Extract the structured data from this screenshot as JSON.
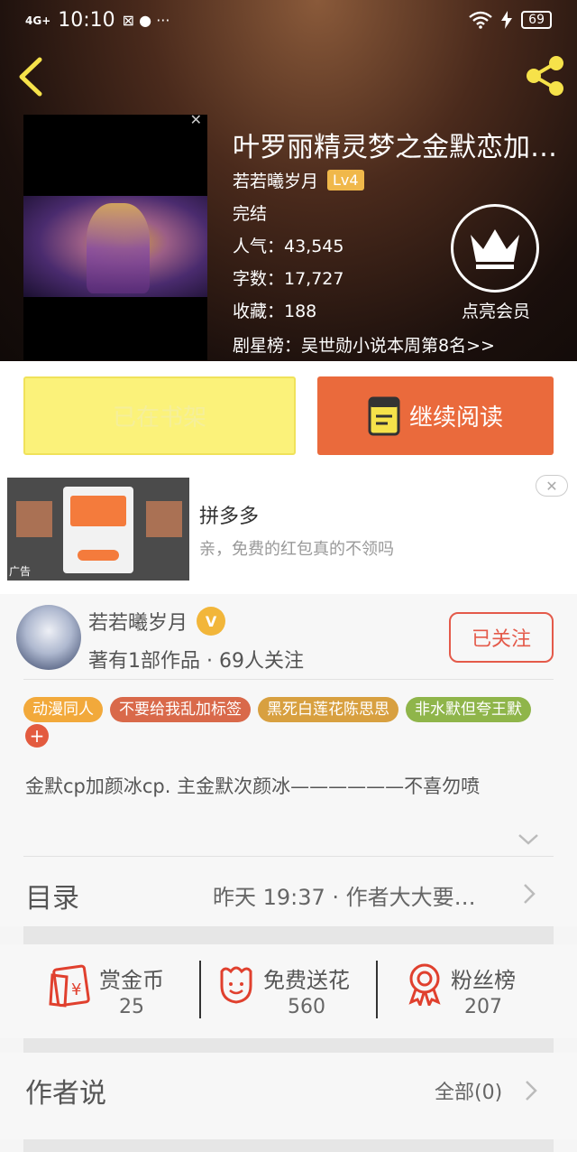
{
  "status_bar": {
    "network": "4G+",
    "time": "10:10",
    "battery": "69"
  },
  "book": {
    "title": "叶罗丽精灵梦之金默恋加…",
    "author": "若若曦岁月",
    "level": "Lv4",
    "status": "完结",
    "popularity": "人气：43,545",
    "word_count": "字数：17,727",
    "favorites": "收藏：188",
    "rank": "剧星榜：吴世勋小说本周第8名>>",
    "vip_label": "点亮会员"
  },
  "actions": {
    "shelf_label": "已在书架",
    "read_label": "继续阅读"
  },
  "ad": {
    "title": "拼多多",
    "description": "亲，免费的红包真的不领吗",
    "tag": "广告",
    "close": "✕"
  },
  "author_card": {
    "name": "若若曦岁月",
    "badge": "V",
    "stats": "著有1部作品 · 69人关注",
    "follow_label": "已关注"
  },
  "tags": [
    {
      "label": "动漫同人",
      "color": "#f2a93b"
    },
    {
      "label": "不要给我乱加标签",
      "color": "#d9694a"
    },
    {
      "label": "黑死白莲花陈思思",
      "color": "#d8a040"
    },
    {
      "label": "非水默但夸王默",
      "color": "#8fb54a"
    }
  ],
  "tag_add": "+",
  "description": "金默cp加颜冰cp. 主金默次颜冰——————不喜勿喷",
  "toc": {
    "label": "目录",
    "latest": "昨天 19:37 · 作者大大要…"
  },
  "support": [
    {
      "label": "赏金币",
      "value": "25",
      "icon": "coin-envelope-icon"
    },
    {
      "label": "免费送花",
      "value": "560",
      "icon": "flower-icon"
    },
    {
      "label": "粉丝榜",
      "value": "207",
      "icon": "medal-icon"
    }
  ],
  "author_says": {
    "label": "作者说",
    "all": "全部(0)"
  },
  "colors": {
    "accent": "#ea6a3c",
    "shelf": "#fbf27a",
    "follow": "#e45a4a",
    "icon_red": "#e0402e"
  }
}
